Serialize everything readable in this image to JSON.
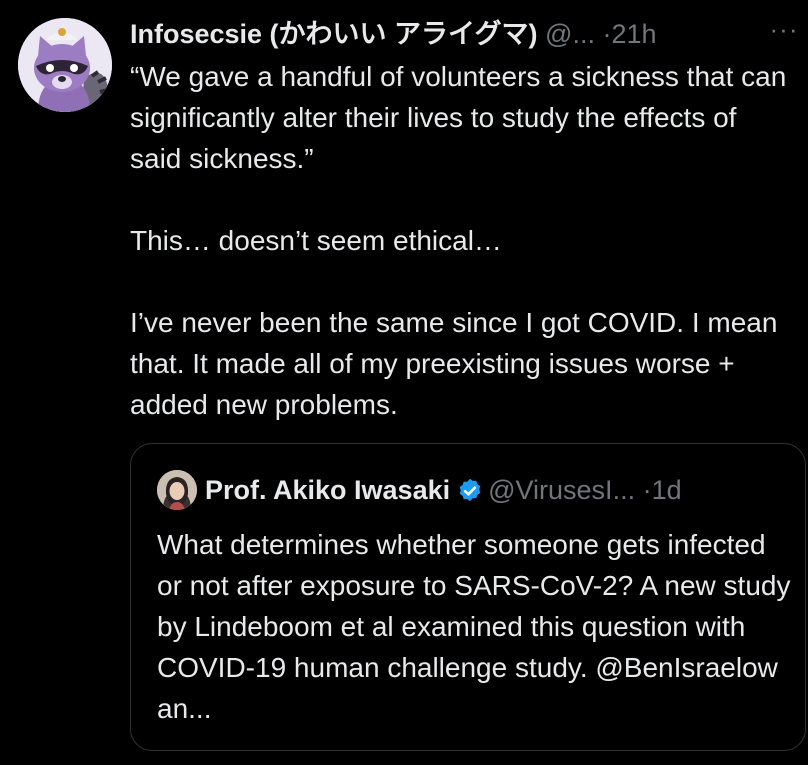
{
  "tweet": {
    "display_name": "Infosecsie (かわいい アライグマ)",
    "handle": "@...",
    "separator": "·",
    "time": "21h",
    "more": "···",
    "paragraphs": [
      "“We gave a handful of volunteers a sickness that can significantly alter their lives to study the effects of said sickness.”",
      "This… doesn’t seem ethical…",
      "I’ve never been the same since I got COVID. I mean that. It made all of my preexisting issues worse + added new problems."
    ]
  },
  "quoted_tweet": {
    "display_name": "Prof. Akiko Iwasaki",
    "handle": "@VirusesI...",
    "separator": "·",
    "time": "1d",
    "verified_color": "#1d9bf0",
    "text": "What determines whether someone gets infected or not after exposure to SARS-CoV-2? A new study by Lindeboom et al examined this question with COVID-19 human challenge study. @BenIsraelow an..."
  },
  "theme": {
    "background": "#000000",
    "text": "#e7e9ea",
    "muted": "#71767b",
    "border": "#2f3336"
  },
  "icons": {
    "avatar": "raccoon-avatar-icon",
    "more": "more-options-icon",
    "verified": "verified-badge-icon"
  }
}
